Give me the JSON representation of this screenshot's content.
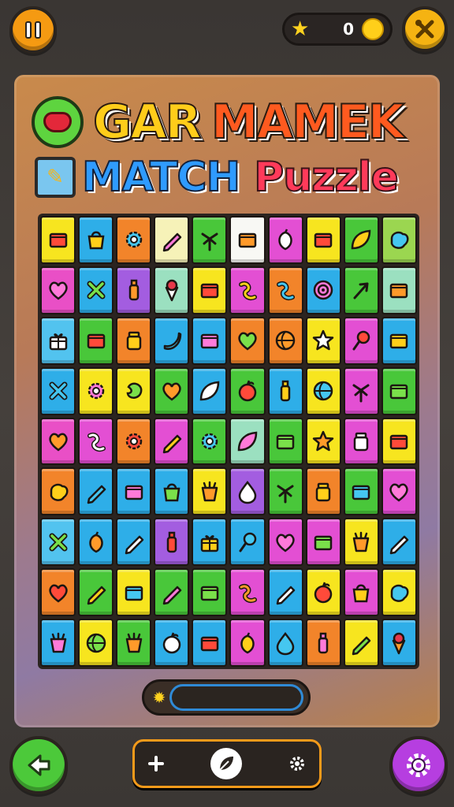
{
  "header": {
    "score_value": "0",
    "pause_icon": "pause-icon",
    "tools_icon": "tools-icon",
    "star_icon": "star-icon",
    "coin_icon": "coin-icon"
  },
  "title": {
    "line1_word1": "GAR",
    "line1_word2": "MAMEK",
    "line2_word1": "MATCH",
    "line2_word2": "Puzzle"
  },
  "progress": {
    "fill_fraction": 0.0,
    "star_icon": "star-icon"
  },
  "bottom": {
    "add_icon": "plus-icon",
    "leaf_icon": "leaf-icon",
    "settings_small_icon": "gear-icon",
    "back_icon": "arrow-left-icon",
    "settings_icon": "gear-icon"
  },
  "colors": {
    "pause": "#f59a12",
    "back": "#4cc93a",
    "settings": "#b63ee0",
    "accent": "#f6a31a"
  },
  "grid": {
    "rows": [
      [
        {
          "c": "#f7e51f",
          "i": "box"
        },
        {
          "c": "#2eaee8",
          "i": "bag"
        },
        {
          "c": "#f2842a",
          "i": "flower"
        },
        {
          "c": "#f6f2b8",
          "i": "pencil"
        },
        {
          "c": "#49c73a",
          "i": "palm"
        },
        {
          "c": "#f8f8f4",
          "i": "box"
        },
        {
          "c": "#e34fd3",
          "i": "fruit"
        },
        {
          "c": "#f7e51f",
          "i": "box"
        },
        {
          "c": "#49c73a",
          "i": "leaf"
        },
        {
          "c": "#9bd650",
          "i": "blob"
        }
      ],
      [
        {
          "c": "#e94fc6",
          "i": "heart"
        },
        {
          "c": "#2eaee8",
          "i": "cross"
        },
        {
          "c": "#a35de0",
          "i": "bottle"
        },
        {
          "c": "#9be0c0",
          "i": "cone"
        },
        {
          "c": "#f7e51f",
          "i": "box"
        },
        {
          "c": "#e34fd3",
          "i": "squig"
        },
        {
          "c": "#f2842a",
          "i": "squig"
        },
        {
          "c": "#2eaee8",
          "i": "spiral"
        },
        {
          "c": "#49c73a",
          "i": "arrow"
        },
        {
          "c": "#9be0c0",
          "i": "box"
        }
      ],
      [
        {
          "c": "#52c3ef",
          "i": "gift"
        },
        {
          "c": "#49c73a",
          "i": "box"
        },
        {
          "c": "#f2842a",
          "i": "jar"
        },
        {
          "c": "#2eaee8",
          "i": "banana"
        },
        {
          "c": "#2eaee8",
          "i": "box"
        },
        {
          "c": "#f2842a",
          "i": "heart"
        },
        {
          "c": "#f2842a",
          "i": "ball"
        },
        {
          "c": "#f7e51f",
          "i": "star"
        },
        {
          "c": "#e34fd3",
          "i": "lolly"
        },
        {
          "c": "#2eaee8",
          "i": "box"
        }
      ],
      [
        {
          "c": "#2eaee8",
          "i": "cross"
        },
        {
          "c": "#f7e51f",
          "i": "flower"
        },
        {
          "c": "#f7e51f",
          "i": "bean"
        },
        {
          "c": "#49c73a",
          "i": "heart"
        },
        {
          "c": "#2eaee8",
          "i": "leaf"
        },
        {
          "c": "#49c73a",
          "i": "apple"
        },
        {
          "c": "#2eaee8",
          "i": "bottle"
        },
        {
          "c": "#f7e51f",
          "i": "ball"
        },
        {
          "c": "#e34fd3",
          "i": "palm"
        },
        {
          "c": "#49c73a",
          "i": "box"
        }
      ],
      [
        {
          "c": "#e94fc6",
          "i": "heart"
        },
        {
          "c": "#e34fd3",
          "i": "squig"
        },
        {
          "c": "#f2842a",
          "i": "flower"
        },
        {
          "c": "#e34fd3",
          "i": "pencil"
        },
        {
          "c": "#49c73a",
          "i": "flower"
        },
        {
          "c": "#9be0c0",
          "i": "leaf"
        },
        {
          "c": "#49c73a",
          "i": "box"
        },
        {
          "c": "#f7e51f",
          "i": "star"
        },
        {
          "c": "#e34fd3",
          "i": "jar"
        },
        {
          "c": "#f7e51f",
          "i": "box"
        }
      ],
      [
        {
          "c": "#f2842a",
          "i": "blob"
        },
        {
          "c": "#2eaee8",
          "i": "pencil"
        },
        {
          "c": "#2eaee8",
          "i": "box"
        },
        {
          "c": "#2eaee8",
          "i": "bag"
        },
        {
          "c": "#f7e51f",
          "i": "cup"
        },
        {
          "c": "#a35de0",
          "i": "drop"
        },
        {
          "c": "#49c73a",
          "i": "palm"
        },
        {
          "c": "#f2842a",
          "i": "jar"
        },
        {
          "c": "#49c73a",
          "i": "box"
        },
        {
          "c": "#e34fd3",
          "i": "heart"
        }
      ],
      [
        {
          "c": "#52c3ef",
          "i": "cross"
        },
        {
          "c": "#2eaee8",
          "i": "fruit"
        },
        {
          "c": "#2eaee8",
          "i": "pencil"
        },
        {
          "c": "#a35de0",
          "i": "bottle"
        },
        {
          "c": "#2eaee8",
          "i": "gift"
        },
        {
          "c": "#2eaee8",
          "i": "lolly"
        },
        {
          "c": "#e34fd3",
          "i": "heart"
        },
        {
          "c": "#e34fd3",
          "i": "box"
        },
        {
          "c": "#f7e51f",
          "i": "cup"
        },
        {
          "c": "#2eaee8",
          "i": "pencil"
        }
      ],
      [
        {
          "c": "#f2842a",
          "i": "heart"
        },
        {
          "c": "#49c73a",
          "i": "pencil"
        },
        {
          "c": "#f7e51f",
          "i": "box"
        },
        {
          "c": "#49c73a",
          "i": "pencil"
        },
        {
          "c": "#49c73a",
          "i": "box"
        },
        {
          "c": "#e34fd3",
          "i": "squig"
        },
        {
          "c": "#2eaee8",
          "i": "pencil"
        },
        {
          "c": "#f7e51f",
          "i": "apple"
        },
        {
          "c": "#e34fd3",
          "i": "bag"
        },
        {
          "c": "#f7e51f",
          "i": "blob"
        }
      ],
      [
        {
          "c": "#2eaee8",
          "i": "cup"
        },
        {
          "c": "#f7e51f",
          "i": "ball"
        },
        {
          "c": "#49c73a",
          "i": "cup"
        },
        {
          "c": "#2eaee8",
          "i": "apple"
        },
        {
          "c": "#2eaee8",
          "i": "box"
        },
        {
          "c": "#e34fd3",
          "i": "fruit"
        },
        {
          "c": "#2eaee8",
          "i": "drop"
        },
        {
          "c": "#f2842a",
          "i": "bottle"
        },
        {
          "c": "#f7e51f",
          "i": "pencil"
        },
        {
          "c": "#2eaee8",
          "i": "cone"
        }
      ]
    ]
  }
}
